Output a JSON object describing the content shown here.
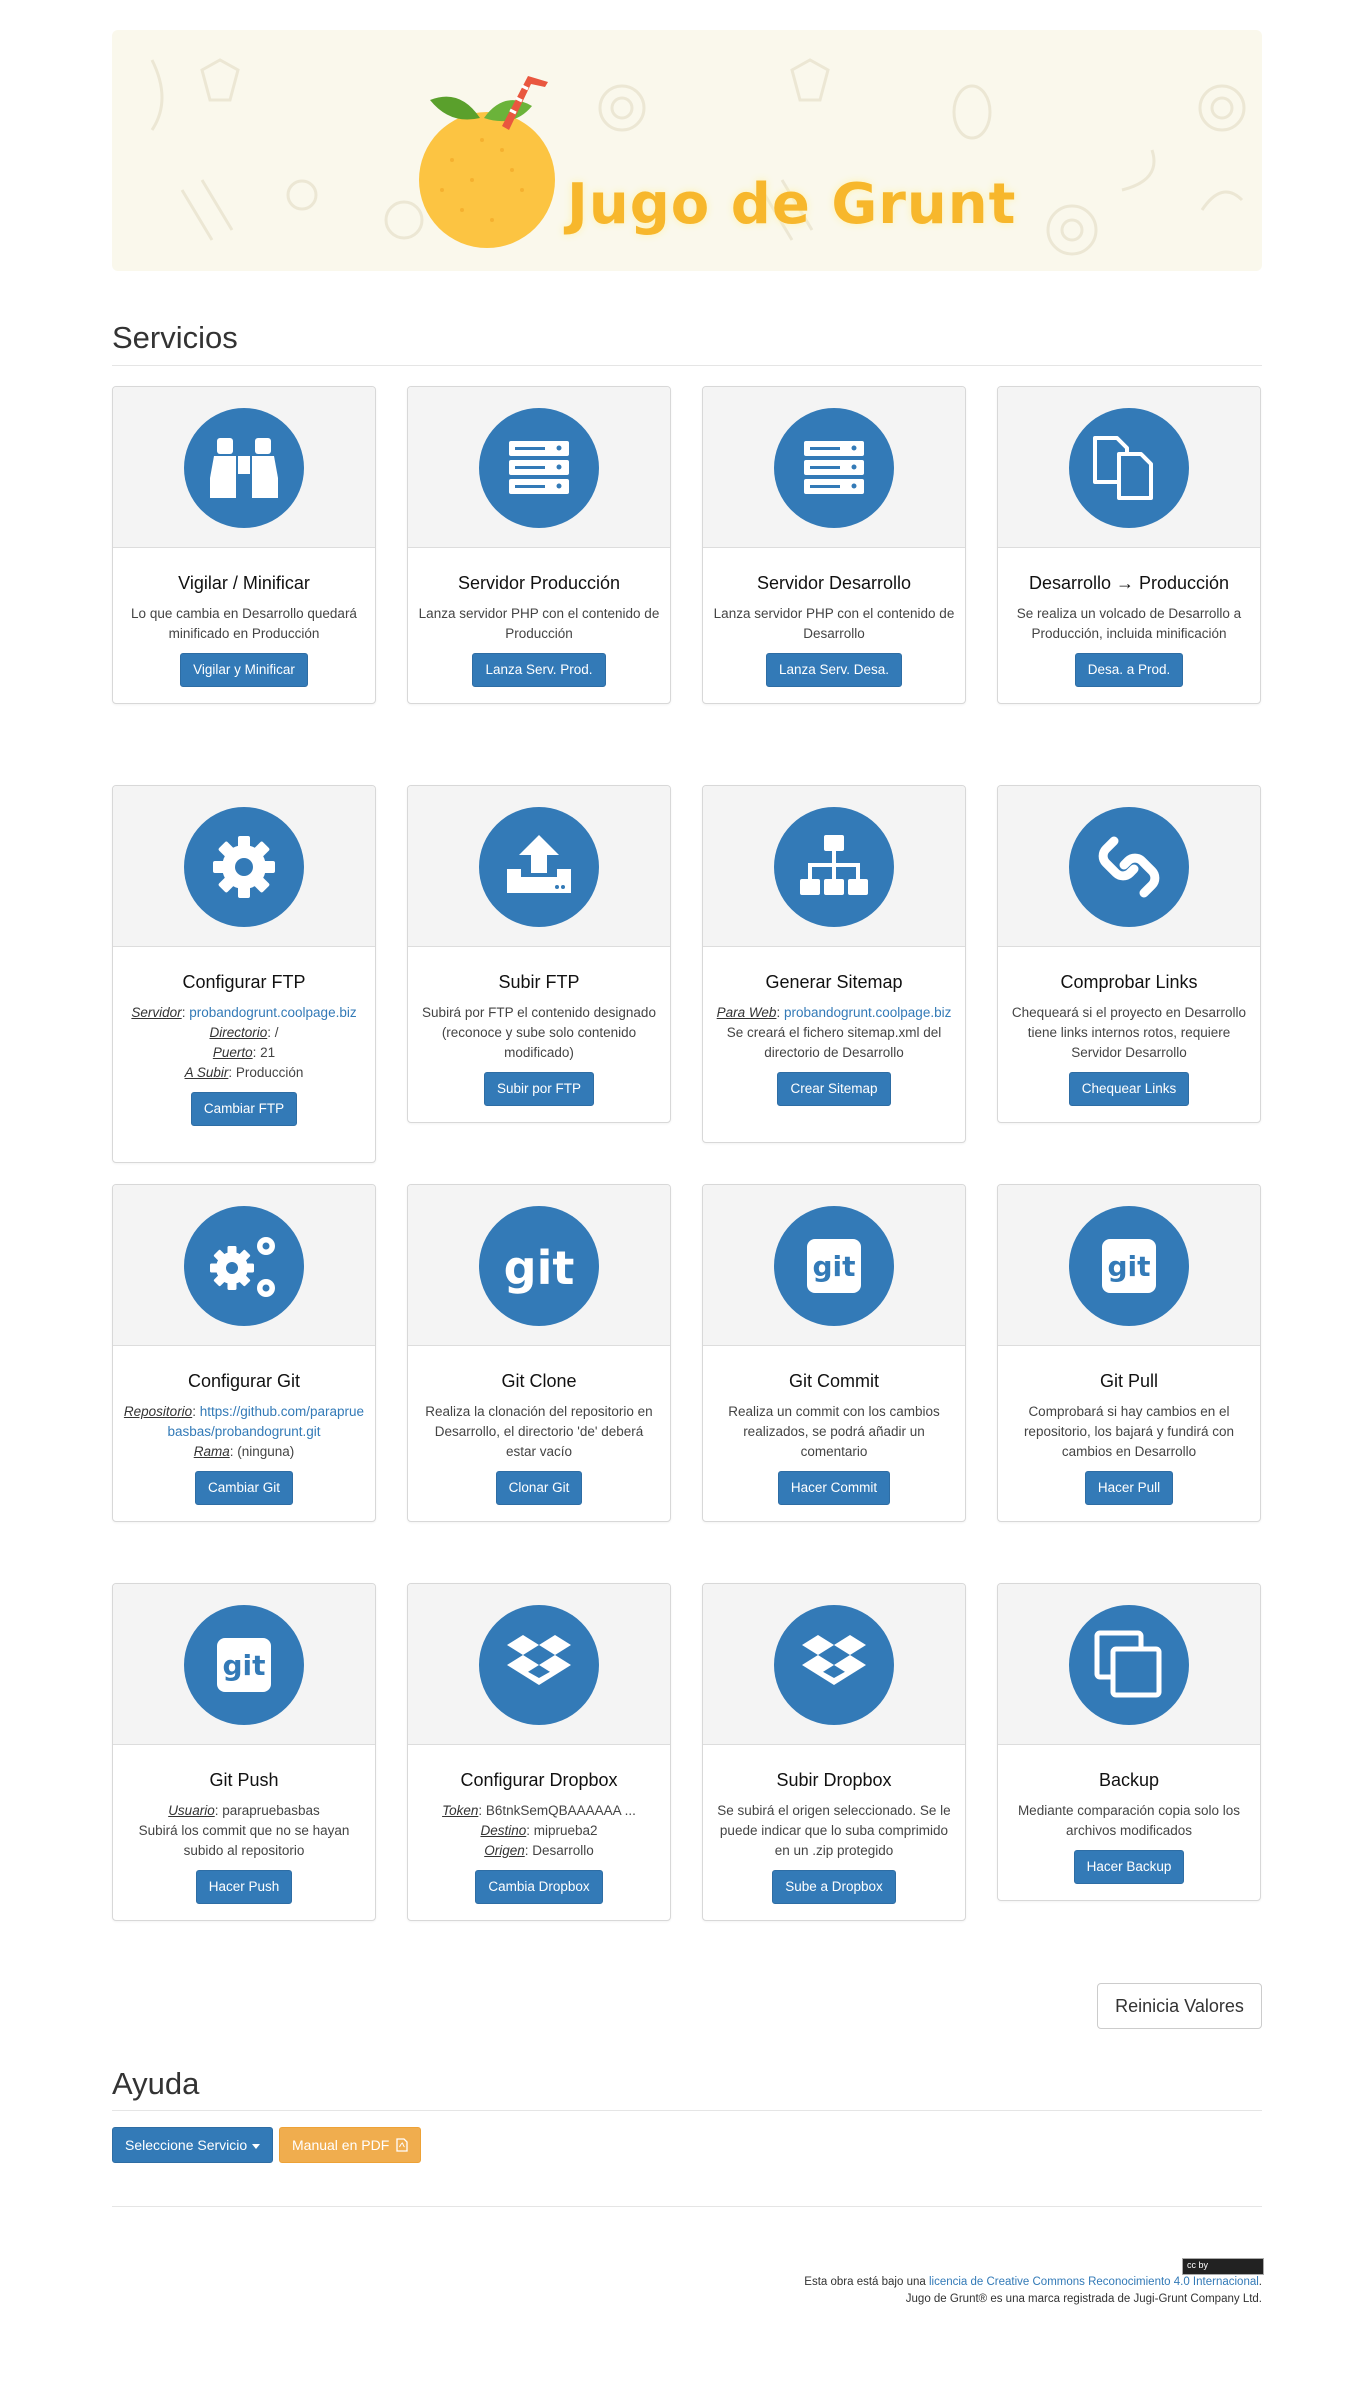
{
  "banner": {
    "title": "Jugo de Grunt"
  },
  "sections": {
    "services": "Servicios",
    "help": "Ayuda"
  },
  "cards": [
    {
      "title": "Vigilar / Minificar",
      "icon": "binoculars-icon",
      "desc": "Lo que cambia en Desarrollo quedará minificado en Producción",
      "button": "Vigilar y Minificar"
    },
    {
      "title": "Servidor Producción",
      "icon": "server-icon",
      "desc": "Lanza servidor PHP con el contenido de Producción",
      "button": "Lanza Serv. Prod."
    },
    {
      "title": "Servidor Desarrollo",
      "icon": "server-icon",
      "desc": "Lanza servidor PHP con el contenido de Desarrollo",
      "button": "Lanza Serv. Desa."
    },
    {
      "title": "Desarrollo → Producción",
      "icon": "copy-files-icon",
      "desc": "Se realiza un volcado de Desarrollo a Producción, incluida minificación",
      "button": "Desa. a Prod."
    },
    {
      "title": "Configurar FTP",
      "icon": "gear-icon",
      "kv": [
        {
          "key": "Servidor",
          "value": "probandogrunt.coolpage.biz",
          "link": true
        },
        {
          "key": "Directorio",
          "value": "/"
        },
        {
          "key": "Puerto",
          "value": "21"
        },
        {
          "key": "A Subir",
          "value": "Producción"
        }
      ],
      "button": "Cambiar FTP"
    },
    {
      "title": "Subir FTP",
      "icon": "upload-icon",
      "desc": "Subirá por FTP el contenido designado (reconoce y sube solo contenido modificado)",
      "button": "Subir por FTP"
    },
    {
      "title": "Generar Sitemap",
      "icon": "sitemap-icon",
      "kv": [
        {
          "key": "Para Web",
          "value": "probandogrunt.coolpage.biz",
          "link": true
        }
      ],
      "desc": "Se creará el fichero sitemap.xml del directorio de Desarrollo",
      "button": "Crear Sitemap"
    },
    {
      "title": "Comprobar Links",
      "icon": "chain-icon",
      "desc": "Chequeará si el proyecto en Desarrollo tiene links internos rotos, requiere Servidor Desarrollo",
      "button": "Chequear Links"
    },
    {
      "title": "Configurar Git",
      "icon": "gears-icon",
      "kv": [
        {
          "key": "Repositorio",
          "value": "https://github.com/parapruebasbas/probandogrunt.git",
          "link": true
        },
        {
          "key": "Rama",
          "value": "(ninguna)"
        }
      ],
      "button": "Cambiar Git"
    },
    {
      "title": "Git Clone",
      "icon": "git-icon",
      "desc": "Realiza la clonación del repositorio en Desarrollo, el directorio 'de' deberá estar vacío",
      "button": "Clonar Git"
    },
    {
      "title": "Git Commit",
      "icon": "git-square-icon",
      "desc": "Realiza un commit con los cambios realizados, se podrá añadir un comentario",
      "button": "Hacer Commit"
    },
    {
      "title": "Git Pull",
      "icon": "git-square-icon",
      "desc": "Comprobará si hay cambios en el repositorio, los bajará y fundirá con cambios en Desarrollo",
      "button": "Hacer Pull"
    },
    {
      "title": "Git Push",
      "icon": "git-square-icon",
      "kv": [
        {
          "key": "Usuario",
          "value": "parapruebasbas"
        }
      ],
      "desc": "Subirá los commit que no se hayan subido al repositorio",
      "button": "Hacer Push"
    },
    {
      "title": "Configurar Dropbox",
      "icon": "dropbox-icon",
      "kv": [
        {
          "key": "Token",
          "value": "B6tnkSemQBAAAAAA ..."
        },
        {
          "key": "Destino",
          "value": "miprueba2"
        },
        {
          "key": "Origen",
          "value": "Desarrollo"
        }
      ],
      "button": "Cambia Dropbox"
    },
    {
      "title": "Subir Dropbox",
      "icon": "dropbox-icon",
      "desc": "Se subirá el origen seleccionado. Se le puede indicar que lo suba comprimido en un .zip protegido",
      "button": "Sube a Dropbox"
    },
    {
      "title": "Backup",
      "icon": "clone-icon",
      "desc": "Mediante comparación copia solo los archivos modificados",
      "button": "Hacer Backup"
    }
  ],
  "reset_button": "Reinicia Valores",
  "help": {
    "select_button": "Seleccione Servicio",
    "manual_button": "Manual en PDF"
  },
  "footer": {
    "line1_prefix": "Esta obra está bajo una ",
    "line1_link": "licencia de Creative Commons Reconocimiento 4.0 Internacional",
    "line1_suffix": ".",
    "line2": "Jugo de Grunt® es una marca registrada de Jugi-Grunt Company Ltd.",
    "badge": "cc by"
  },
  "colors": {
    "primary": "#337ab7",
    "warning": "#f0ad4e",
    "banner_title": "#f7b72c"
  }
}
